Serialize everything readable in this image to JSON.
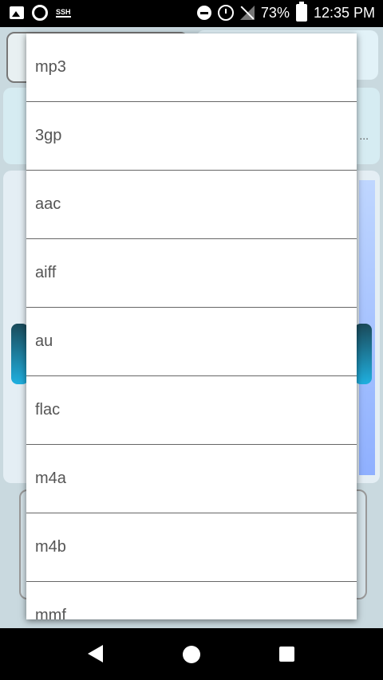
{
  "status_bar": {
    "battery_percent": "73%",
    "time": "12:35 PM",
    "left_icons": [
      "image-icon",
      "ring-icon",
      "ssh-icon"
    ],
    "right_icons": [
      "dnd-icon",
      "alarm-icon",
      "no-signal-icon",
      "battery-charging-icon"
    ],
    "ssh_text": "SSH"
  },
  "background": {
    "ellipsis": "..."
  },
  "dropdown": {
    "options": [
      "mp3",
      "3gp",
      "aac",
      "aiff",
      "au",
      "flac",
      "m4a",
      "m4b",
      "mmf"
    ]
  },
  "nav_bar": {
    "icons": [
      "back-icon",
      "home-icon",
      "recents-icon"
    ]
  }
}
